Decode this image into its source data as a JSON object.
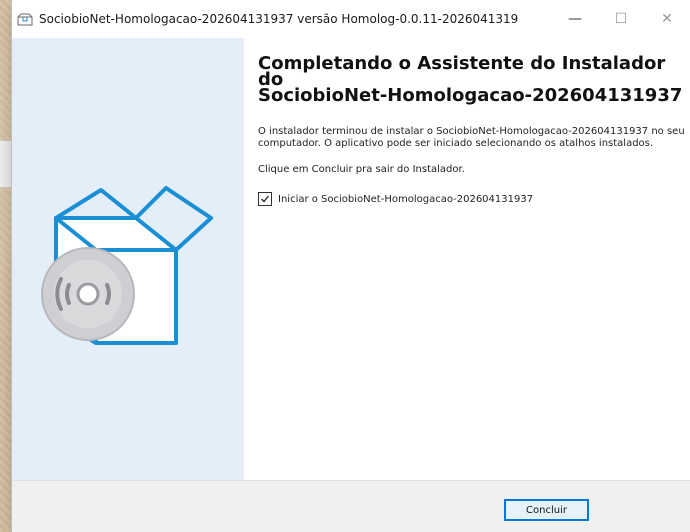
{
  "window": {
    "title": "SociobioNet-Homologacao-202604131937 versão Homolog-0.0.11-2026041319...",
    "minimize": "—",
    "maximize": "☐",
    "close": "✕"
  },
  "main": {
    "heading_line1": "Completando o Assistente do Instalador",
    "heading_line2": "do",
    "heading_line3": "SociobioNet-Homologacao-202604131937",
    "paragraph": "O instalador terminou de instalar o SociobioNet-Homologacao-202604131937 no seu computador. O aplicativo pode ser iniciado selecionando os atalhos instalados.",
    "paragraph2": "Clique em Concluir pra sair do Instalador.",
    "checkbox_label": "Iniciar o SociobioNet-Homologacao-202604131937",
    "checkbox_checked": true
  },
  "footer": {
    "finish_label": "Concluir"
  },
  "colors": {
    "accent": "#0078d7",
    "side_panel": "#e3eef8",
    "icon_blue": "#1a8fd6"
  },
  "icons": [
    "installer-icon",
    "box-disc-icon",
    "check-icon"
  ]
}
